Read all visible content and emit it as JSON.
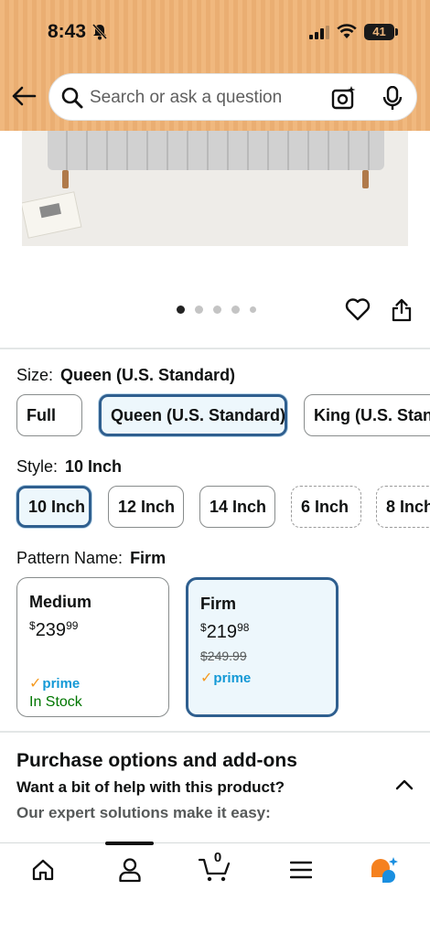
{
  "status_bar": {
    "time": "8:43",
    "battery": "41"
  },
  "search": {
    "placeholder": "Search or ask a question"
  },
  "gallery": {
    "image_count": 5,
    "active_index": 0
  },
  "size": {
    "label": "Size:",
    "selected": "Queen (U.S. Standard)",
    "options": [
      "Full",
      "Queen (U.S. Standard)",
      "King (U.S. Standard)"
    ]
  },
  "style": {
    "label": "Style:",
    "selected": "10 Inch",
    "options": [
      "10 Inch",
      "12 Inch",
      "14 Inch",
      "6 Inch",
      "8 Inch"
    ]
  },
  "pattern": {
    "label": "Pattern Name:",
    "selected": "Firm",
    "options": [
      {
        "name": "Medium",
        "currency": "$",
        "price_whole": "239",
        "price_fraction": "99",
        "prime": "prime",
        "stock": "In Stock"
      },
      {
        "name": "Firm",
        "currency": "$",
        "price_whole": "219",
        "price_fraction": "98",
        "list_price": "$249.99",
        "prime": "prime"
      }
    ]
  },
  "purchase_options": {
    "title": "Purchase options and add-ons",
    "help_title": "Want a bit of help with this product?",
    "help_subtitle": "Our expert solutions make it easy:"
  },
  "bottom_nav": {
    "cart_count": "0",
    "active": "account"
  },
  "colors": {
    "header": "#f0b87e",
    "selected_border": "#2f5f8f",
    "selected_bg": "#edf7fc",
    "prime_blue": "#1399d6",
    "in_stock": "#007600"
  }
}
